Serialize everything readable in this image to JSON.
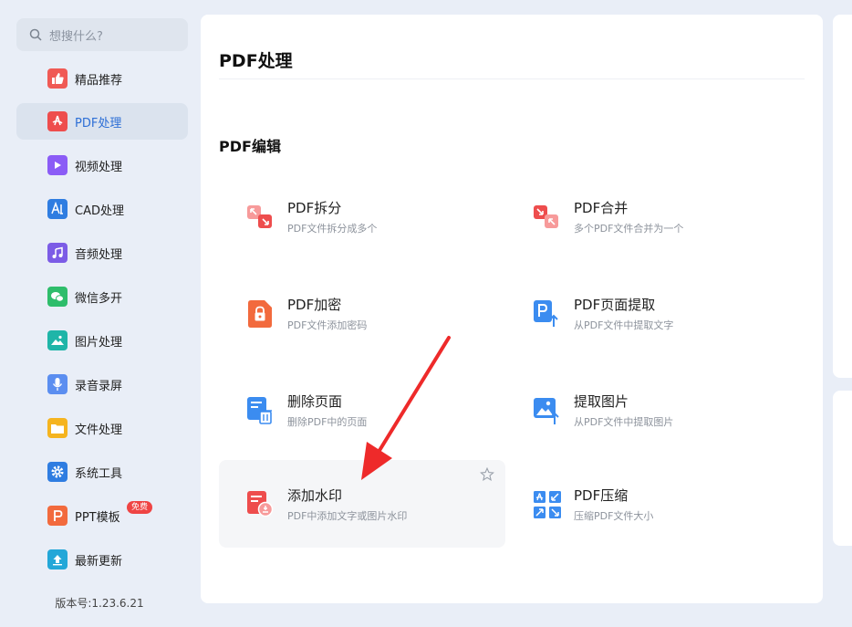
{
  "search": {
    "placeholder": "想搜什么?"
  },
  "sidebar": {
    "items": [
      {
        "label": "精品推荐",
        "icon": "thumbs-up-icon",
        "color": "#f05a55"
      },
      {
        "label": "PDF处理",
        "icon": "pdf-icon",
        "color": "#ee4d4d",
        "active": true
      },
      {
        "label": "视频处理",
        "icon": "video-play-icon",
        "color": "#8b5cf6"
      },
      {
        "label": "CAD处理",
        "icon": "cad-icon",
        "color": "#2f7de1"
      },
      {
        "label": "音频处理",
        "icon": "music-note-icon",
        "color": "#7c5ce6"
      },
      {
        "label": "微信多开",
        "icon": "wechat-icon",
        "color": "#2ebd6b"
      },
      {
        "label": "图片处理",
        "icon": "image-icon",
        "color": "#1fb5a8"
      },
      {
        "label": "录音录屏",
        "icon": "microphone-icon",
        "color": "#5b8ef0"
      },
      {
        "label": "文件处理",
        "icon": "folder-icon",
        "color": "#f5b41f"
      },
      {
        "label": "系统工具",
        "icon": "gear-icon",
        "color": "#2f7de1"
      },
      {
        "label": "PPT模板",
        "icon": "ppt-icon",
        "color": "#f26a3d",
        "badge": "免费"
      },
      {
        "label": "最新更新",
        "icon": "upload-icon",
        "color": "#23a7d8"
      }
    ],
    "version": "版本号:1.23.6.21"
  },
  "main": {
    "title": "PDF处理",
    "section": "PDF编辑",
    "tools": [
      {
        "name": "PDF拆分",
        "desc": "PDF文件拆分成多个",
        "icon": "pdf-split-icon"
      },
      {
        "name": "PDF合并",
        "desc": "多个PDF文件合并为一个",
        "icon": "pdf-merge-icon"
      },
      {
        "name": "PDF加密",
        "desc": "PDF文件添加密码",
        "icon": "pdf-lock-icon"
      },
      {
        "name": "PDF页面提取",
        "desc": "从PDF文件中提取文字",
        "icon": "pdf-page-extract-icon"
      },
      {
        "name": "删除页面",
        "desc": "删除PDF中的页面",
        "icon": "delete-page-icon"
      },
      {
        "name": "提取图片",
        "desc": "从PDF文件中提取图片",
        "icon": "extract-image-icon"
      },
      {
        "name": "添加水印",
        "desc": "PDF中添加文字或图片水印",
        "icon": "watermark-icon"
      },
      {
        "name": "PDF压缩",
        "desc": "压缩PDF文件大小",
        "icon": "pdf-compress-icon"
      }
    ]
  },
  "colors": {
    "accent": "#2d6fd6",
    "red": "#ee4d4d",
    "blue": "#3b8cf0",
    "arrow": "#ee2a2a"
  }
}
